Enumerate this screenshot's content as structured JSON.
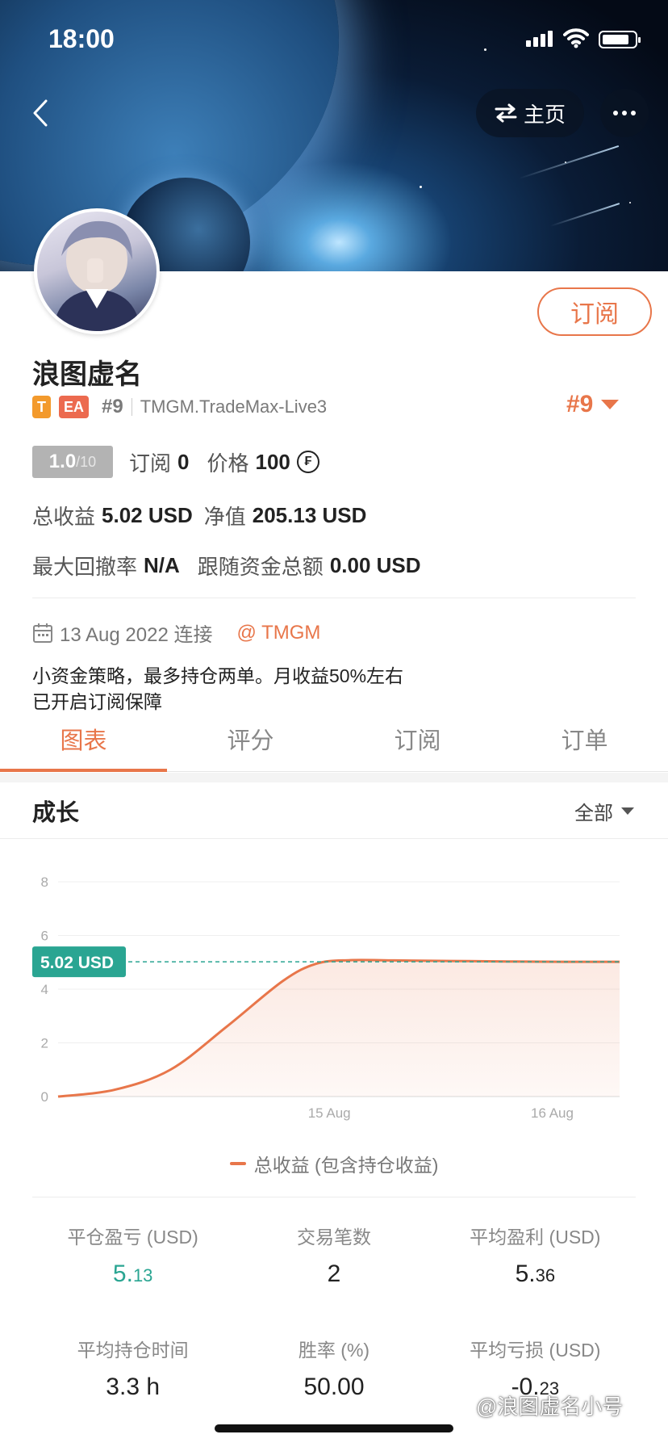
{
  "status_bar": {
    "time": "18:00"
  },
  "header": {
    "home_label": "主页"
  },
  "profile": {
    "subscribe_label": "订阅",
    "name": "浪图虚名",
    "tag_t": "T",
    "tag_ea": "EA",
    "rank_small": "#9",
    "server": "TMGM.TradeMax-Live3",
    "rank_big": "#9",
    "score": "1.0",
    "score_max": "/10",
    "subs_label": "订阅",
    "subs_value": "0",
    "price_label": "价格",
    "price_value": "100",
    "total_profit_label": "总收益",
    "total_profit_value": "5.02 USD",
    "equity_label": "净值",
    "equity_value": "205.13 USD",
    "max_dd_label": "最大回撤率",
    "max_dd_value": "N/A",
    "follow_funds_label": "跟随资金总额",
    "follow_funds_value": "0.00 USD",
    "connected_date": "13 Aug 2022 连接",
    "broker": "@ TMGM",
    "desc_line1": "小资金策略，最多持仓两单。月收益50%左右",
    "desc_line2": "已开启订阅保障"
  },
  "tabs": [
    {
      "label": "图表",
      "active": true
    },
    {
      "label": "评分",
      "active": false
    },
    {
      "label": "订阅",
      "active": false
    },
    {
      "label": "订单",
      "active": false
    }
  ],
  "section": {
    "title": "成长",
    "filter": "全部"
  },
  "chart_data": {
    "type": "area",
    "x_ticks": [
      "15 Aug",
      "16 Aug"
    ],
    "y_ticks": [
      "0",
      "2",
      "4",
      "6",
      "8"
    ],
    "ylim": [
      0,
      8
    ],
    "series": [
      {
        "name": "总收益 (包含持仓收益)",
        "color": "#e8764a",
        "x": [
          0,
          0.1,
          0.2,
          0.3,
          0.4,
          0.46,
          0.52,
          0.6,
          0.7,
          0.8,
          0.9,
          1.0
        ],
        "values": [
          0,
          0.25,
          1.0,
          2.6,
          4.3,
          4.95,
          5.08,
          5.07,
          5.05,
          5.03,
          5.02,
          5.02
        ]
      }
    ],
    "current_label": "5.02 USD",
    "current_value": 5.02,
    "grid": true
  },
  "legend_label": "总收益 (包含持仓收益)",
  "stats": [
    {
      "label": "平仓盈亏 (USD)",
      "major": "5.",
      "minor": "13",
      "green": true
    },
    {
      "label": "交易笔数",
      "major": "2",
      "minor": "",
      "green": false
    },
    {
      "label": "平均盈利 (USD)",
      "major": "5.",
      "minor": "36",
      "green": false
    },
    {
      "label": "平均持仓时间",
      "major": "3.3 h",
      "minor": "",
      "green": false
    },
    {
      "label": "胜率 (%)",
      "major": "50.00",
      "minor": "",
      "green": false
    },
    {
      "label": "平均亏损 (USD)",
      "major": "-0.",
      "minor": "23",
      "green": false
    }
  ],
  "watermark": "@浪图虚名小号"
}
